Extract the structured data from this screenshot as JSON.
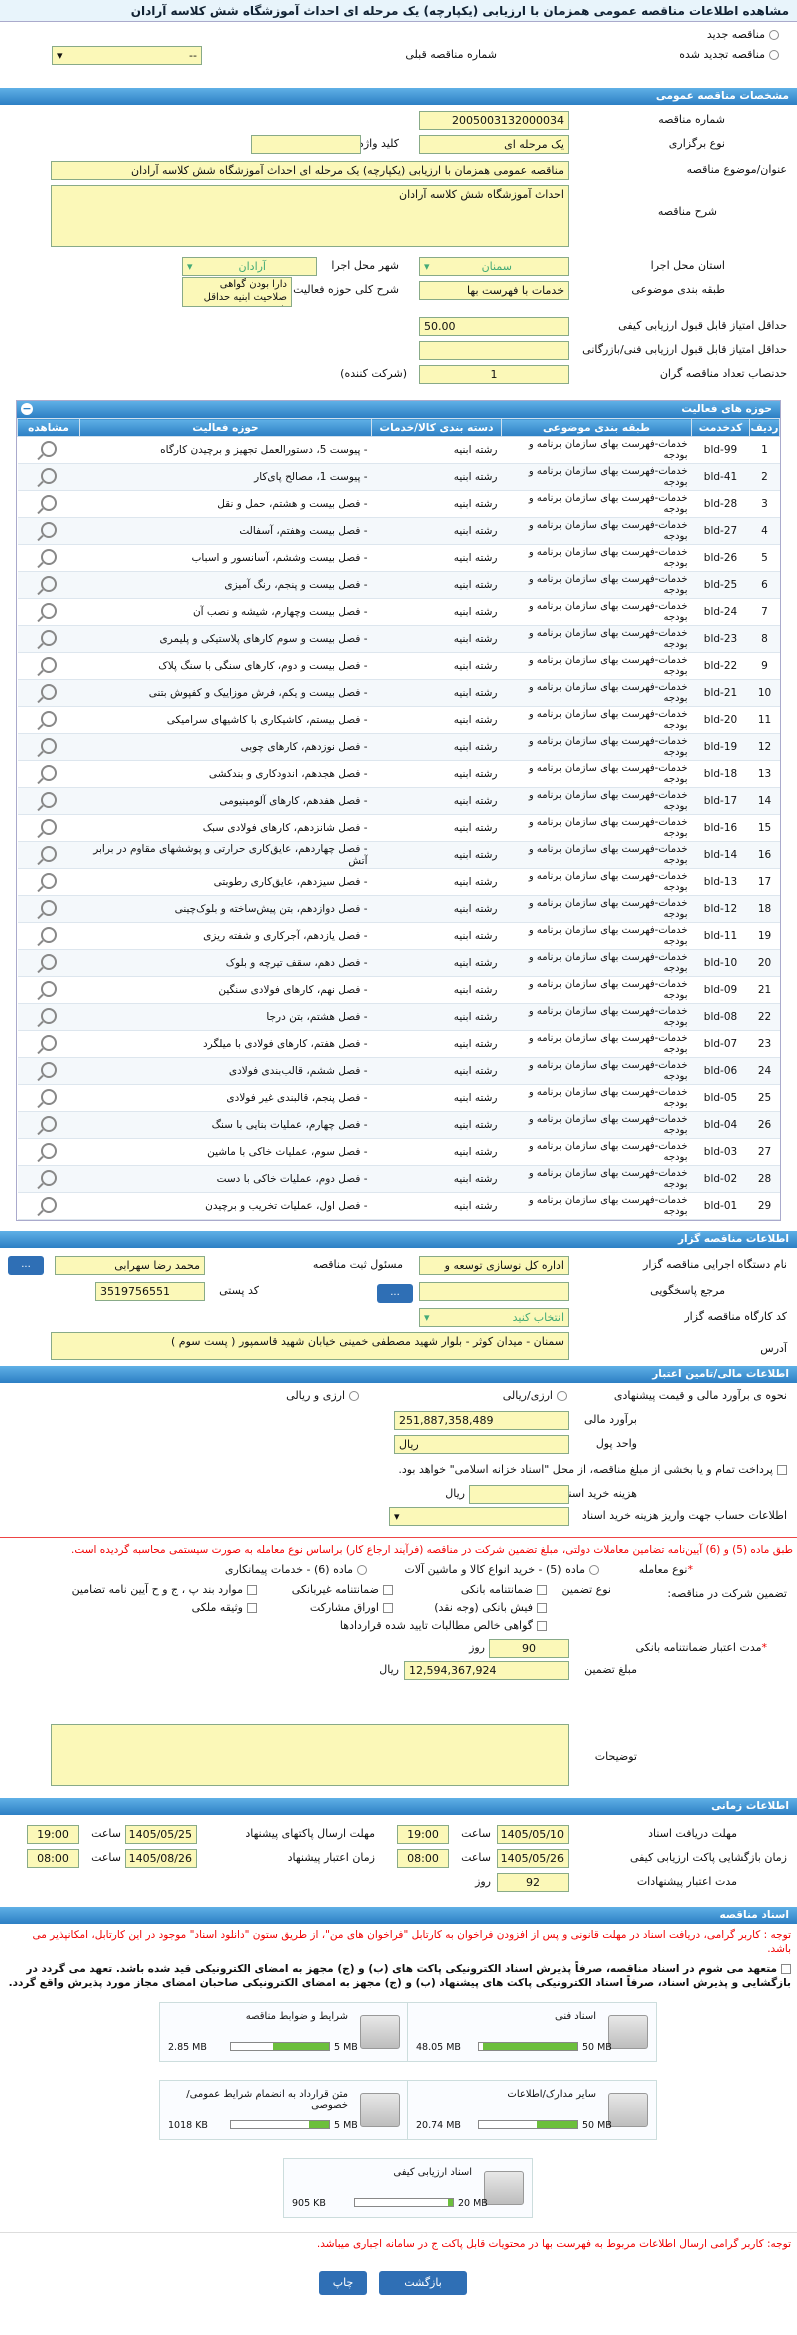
{
  "header": {
    "title": "مشاهده اطلاعات مناقصه عمومی همزمان با ارزیابی (یکپارچه) یک مرحله ای احداث آموزشگاه شش کلاسه آرادان"
  },
  "top": {
    "new": "مناقصه جدید",
    "renewed": "مناقصه تجدید شده",
    "prev_label": "شماره مناقصه قبلی",
    "prev_value": "--"
  },
  "general": {
    "title": "مشخصات مناقصه عمومی",
    "number_label": "شماره مناقصه",
    "number": "2005003132000034",
    "type_label": "نوع برگزاری",
    "type": "یک مرحله ای",
    "keyword_label": "کلید واژه",
    "keyword": "",
    "subject_label": "عنوان/موضوع مناقصه",
    "subject": "مناقصه عمومی همزمان با ارزیابی (یکپارچه) یک مرحله ای  احداث آموزشگاه شش کلاسه آرادان",
    "desc_label": "شرح مناقصه",
    "desc": "احداث آموزشگاه شش کلاسه آرادان",
    "province_label": "استان محل اجرا",
    "province": "سمنان",
    "city_label": "شهر محل اجرا",
    "city": "آرادان",
    "category_label": "طبقه بندی موضوعی",
    "category": "خدمات با فهرست بها",
    "scope_label": "شرح کلی حوزه فعالیت",
    "scope": "دارا بودن گواهی صلاحیت ابنیه حداقل پایه 5",
    "quality_label": "حداقل امتیاز قابل قبول ارزیابی کیفی",
    "quality": "50.00",
    "tech_label": "حداقل امتیاز قابل قبول ارزیابی فنی/بازرگانی",
    "tech": "",
    "count_label": "حدنصاب تعداد مناقصه گران",
    "count": "1",
    "count_unit": "(شرکت کننده)"
  },
  "activities": {
    "title": "حوزه های فعالیت",
    "cols": [
      "ردیف",
      "کدخدمت",
      "طبقه بندی موضوعی",
      "دسته بندی کالا/خدمات",
      "حوزه فعالیت",
      "مشاهده"
    ],
    "rows": [
      [
        "1",
        "bld-99",
        "خدمات-فهرست بهای سازمان برنامه و بودجه",
        "رشته ابنیه",
        "- پیوست 5، دستورالعمل تجهیز و برچیدن کارگاه"
      ],
      [
        "2",
        "bld-41",
        "خدمات-فهرست بهای سازمان برنامه و بودجه",
        "رشته ابنیه",
        "- پیوست 1، مصالح پای‌کار"
      ],
      [
        "3",
        "bld-28",
        "خدمات-فهرست بهای سازمان برنامه و بودجه",
        "رشته ابنیه",
        "- فصل بیست و هشتم، حمل و نقل"
      ],
      [
        "4",
        "bld-27",
        "خدمات-فهرست بهای سازمان برنامه و بودجه",
        "رشته ابنیه",
        "- فصل بیست وهفتم، آسفالت"
      ],
      [
        "5",
        "bld-26",
        "خدمات-فهرست بهای سازمان برنامه و بودجه",
        "رشته ابنیه",
        "- فصل بیست وششم، آسانسور و اسباب"
      ],
      [
        "6",
        "bld-25",
        "خدمات-فهرست بهای سازمان برنامه و بودجه",
        "رشته ابنیه",
        "- فصل بیست و پنجم، رنگ آمیزی"
      ],
      [
        "7",
        "bld-24",
        "خدمات-فهرست بهای سازمان برنامه و بودجه",
        "رشته ابنیه",
        "- فصل بیست وچهارم، شیشه و نصب آن"
      ],
      [
        "8",
        "bld-23",
        "خدمات-فهرست بهای سازمان برنامه و بودجه",
        "رشته ابنیه",
        "- فصل بیست و سوم کارهای پلاستیکی و پلیمری"
      ],
      [
        "9",
        "bld-22",
        "خدمات-فهرست بهای سازمان برنامه و بودجه",
        "رشته ابنیه",
        "- فصل بیست و دوم، کارهای سنگی با سنگ پلاک"
      ],
      [
        "10",
        "bld-21",
        "خدمات-فهرست بهای سازمان برنامه و بودجه",
        "رشته ابنیه",
        "- فصل بیست و یکم، فرش موزاییک و کفپوش بتنی"
      ],
      [
        "11",
        "bld-20",
        "خدمات-فهرست بهای سازمان برنامه و بودجه",
        "رشته ابنیه",
        "- فصل بیستم، کاشیکاری با کاشیهای سرامیکی"
      ],
      [
        "12",
        "bld-19",
        "خدمات-فهرست بهای سازمان برنامه و بودجه",
        "رشته ابنیه",
        "- فصل نوزدهم، کارهای چوبی"
      ],
      [
        "13",
        "bld-18",
        "خدمات-فهرست بهای سازمان برنامه و بودجه",
        "رشته ابنیه",
        "- فصل هجدهم، اندودکاری و بندکشی"
      ],
      [
        "14",
        "bld-17",
        "خدمات-فهرست بهای سازمان برنامه و بودجه",
        "رشته ابنیه",
        "- فصل هفدهم، کارهای آلومینیومی"
      ],
      [
        "15",
        "bld-16",
        "خدمات-فهرست بهای سازمان برنامه و بودجه",
        "رشته ابنیه",
        "- فصل شانزدهم، کارهای فولادی سبک"
      ],
      [
        "16",
        "bld-14",
        "خدمات-فهرست بهای سازمان برنامه و بودجه",
        "رشته ابنیه",
        "- فصل چهاردهم، عایق‌کاری حرارتی و پوششهای مقاوم در برابر آتش"
      ],
      [
        "17",
        "bld-13",
        "خدمات-فهرست بهای سازمان برنامه و بودجه",
        "رشته ابنیه",
        "- فصل سیزدهم، عایق‌کاری رطوبتی"
      ],
      [
        "18",
        "bld-12",
        "خدمات-فهرست بهای سازمان برنامه و بودجه",
        "رشته ابنیه",
        "- فصل دوازدهم، بتن پیش‌ساخته و بلوک‌چینی"
      ],
      [
        "19",
        "bld-11",
        "خدمات-فهرست بهای سازمان برنامه و بودجه",
        "رشته ابنیه",
        "- فصل یازدهم، آجرکاری و شفته ریزی"
      ],
      [
        "20",
        "bld-10",
        "خدمات-فهرست بهای سازمان برنامه و بودجه",
        "رشته ابنیه",
        "- فصل دهم، سقف تیرچه و بلوک"
      ],
      [
        "21",
        "bld-09",
        "خدمات-فهرست بهای سازمان برنامه و بودجه",
        "رشته ابنیه",
        "- فصل نهم، کارهای فولادی سنگین"
      ],
      [
        "22",
        "bld-08",
        "خدمات-فهرست بهای سازمان برنامه و بودجه",
        "رشته ابنیه",
        "- فصل هشتم، بتن درجا"
      ],
      [
        "23",
        "bld-07",
        "خدمات-فهرست بهای سازمان برنامه و بودجه",
        "رشته ابنیه",
        "- فصل هفتم، کارهای فولادی با میلگرد"
      ],
      [
        "24",
        "bld-06",
        "خدمات-فهرست بهای سازمان برنامه و بودجه",
        "رشته ابنیه",
        "- فصل ششم، قالب‌بندی فولادی"
      ],
      [
        "25",
        "bld-05",
        "خدمات-فهرست بهای سازمان برنامه و بودجه",
        "رشته ابنیه",
        "- فصل پنجم، قالبندی غیر فولادی"
      ],
      [
        "26",
        "bld-04",
        "خدمات-فهرست بهای سازمان برنامه و بودجه",
        "رشته ابنیه",
        "- فصل چهارم، عملیات بنایی با سنگ"
      ],
      [
        "27",
        "bld-03",
        "خدمات-فهرست بهای سازمان برنامه و بودجه",
        "رشته ابنیه",
        "- فصل سوم، عملیات خاکی با ماشین"
      ],
      [
        "28",
        "bld-02",
        "خدمات-فهرست بهای سازمان برنامه و بودجه",
        "رشته ابنیه",
        "- فصل دوم، عملیات خاکی با دست"
      ],
      [
        "29",
        "bld-01",
        "خدمات-فهرست بهای سازمان برنامه و بودجه",
        "رشته ابنیه",
        "- فصل اول، عملیات تخریب و برچیدن"
      ]
    ]
  },
  "organizer": {
    "title": "اطلاعات مناقصه گزار",
    "org_label": "نام دستگاه اجرایی مناقصه گزار",
    "org": "اداره کل نوسازی   توسعه و",
    "resp_label": "مسئول ثبت مناقصه",
    "resp": "محمد رضا  سهرابی",
    "ref_label": "مرجع پاسخگویی",
    "ref": "",
    "postal_label": "کد پستی",
    "postal": "3519756551",
    "workshop_label": "کد کارگاه مناقصه گزار",
    "workshop": "انتخاب کنید",
    "address_label": "آدرس",
    "address": "سمنان - میدان کوثر - بلوار شهید مصطفی خمینی خیابان شهید قاسمپور ( پست سوم )",
    "more": "..."
  },
  "finance": {
    "title": "اطلاعات مالی/تامین اعتبار",
    "method_label": "نحوه ی برآورد مالی و قیمت پیشنهادی",
    "opt1": "ارزی/ریالی",
    "opt2": "ارزی و ریالی",
    "estimate_label": "برآورد مالی",
    "estimate": "251,887,358,489",
    "unit_label": "واحد پول",
    "unit": "ریال",
    "treasury": "پرداخت تمام و یا بخشی از مبلغ مناقصه، از محل \"اسناد خزانه اسلامی\" خواهد بود.",
    "doc_cost_label": "هزینه خرید اسناد",
    "doc_cost": "",
    "doc_cost_unit": "ریال",
    "account_label": "اطلاعات حساب جهت واریز هزینه خرید اسناد",
    "notice": "طبق ماده (5) و (6) آیین‌نامه تضامین معاملات دولتی، مبلغ تضمین شرکت در مناقصه (فرآیند ارجاع کار) براساس نوع معامله به صورت سیستمی محاسبه گردیده است.",
    "deal_label": "نوع معامله",
    "deal1": "ماده (5) - خرید انواع کالا و ماشین آلات",
    "deal2": "ماده (6) - خدمات پیمانکاری",
    "guar_label": "تضمین شرکت در مناقصه:",
    "guar_type_label": "نوع تضمین",
    "g1": "ضمانتنامه بانکی",
    "g2": "ضمانتنامه غیربانکی",
    "g3": "موارد بند پ ، ج و ح آیین نامه تضامین",
    "g4": "فیش بانکی (وجه نقد)",
    "g5": "اوراق مشارکت",
    "g6": "وثیقه ملکی",
    "g7": "گواهی خالص مطالبات تایید شده قراردادها",
    "validity_label": "مدت اعتبار ضمانتنامه بانکی",
    "validity": "90",
    "validity_unit": "روز",
    "guar_amount_label": "مبلغ تضمین",
    "guar_amount": "12,594,367,924",
    "guar_unit": "ریال",
    "notes_label": "توضیحات"
  },
  "times": {
    "title": "اطلاعات زمانی",
    "pub_label": "مهلت دریافت اسناد",
    "pub_date": "1405/05/10",
    "pub_time": "19:00",
    "send_label": "مهلت ارسال پاکتهای پیشنهاد",
    "send_date": "1405/05/25",
    "send_time": "19:00",
    "open_label": "زمان بازگشایی پاکت ارزیابی کیفی",
    "open_date": "1405/05/26",
    "open_time": "08:00",
    "valid_label": "زمان اعتبار پیشنهاد",
    "valid_date": "1405/08/26",
    "valid_time": "08:00",
    "dur_label": "مدت اعتبار پیشنهادات",
    "dur": "92",
    "dur_unit": "روز",
    "time_word": "ساعت"
  },
  "docs": {
    "title": "اسناد مناقصه",
    "note1": "توجه : کاربر گرامی، دریافت اسناد در مهلت قانونی و پس از افزودن فراخوان به کارتابل \"فراخوان های من\"، از طریق ستون \"دانلود اسناد\" موجود در این کارتابل، امکانپذیر می باشد.",
    "commit": "متعهد می شوم در اسناد مناقصه، صرفاً پذیرش اسناد الکترونیکی پاکت های (ب) و (ج) مجهز به امضای الکترونیکی قید شده باشد. تعهد می گردد در بازگشایی و پذیرش اسناد، صرفاً اسناد الکترونیکی پاکت های پیشنهاد (ب) و (ج) مجهز به امضای الکترونیکی صاحبان امضای مجاز مورد پذیرش واقع گردد.",
    "files": [
      {
        "name": "شرایط و ضوابط مناقصه",
        "size": "2.85 MB",
        "max": "5 MB",
        "pct": 57
      },
      {
        "name": "اسناد فنی",
        "size": "48.05 MB",
        "max": "50 MB",
        "pct": 96
      },
      {
        "name": "متن قرارداد به انضمام شرایط عمومی/خصوصی",
        "size": "1018 KB",
        "max": "5 MB",
        "pct": 20
      },
      {
        "name": "سایر مدارک/اطلاعات",
        "size": "20.74 MB",
        "max": "50 MB",
        "pct": 41
      },
      {
        "name": "اسناد ارزیابی کیفی",
        "size": "905 KB",
        "max": "20 MB",
        "pct": 5
      }
    ],
    "note2": "توجه: کاربر گرامی ارسال اطلاعات مربوط به فهرست بها در محتویات قابل پاکت ج در سامانه اجباری میباشد."
  },
  "footer": {
    "print": "چاپ",
    "back": "بازگشت"
  },
  "colors": {
    "section": "#2c7fc4",
    "field": "#fbf8b8",
    "required": "#e00"
  }
}
